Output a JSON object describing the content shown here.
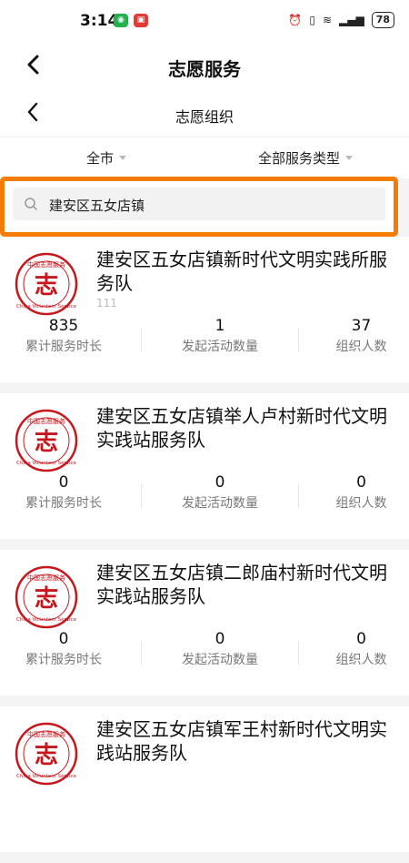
{
  "status": {
    "time": "3:14",
    "battery": "78",
    "app_badge_1_color": "#22b14c",
    "app_badge_2_color": "#e53935"
  },
  "nav": {
    "title": "志愿服务",
    "subtitle": "志愿组织"
  },
  "filters": {
    "area": "全市",
    "type": "全部服务类型"
  },
  "search": {
    "value": "建安区五女店镇"
  },
  "highlight_color": "#f57c00",
  "stat_labels": {
    "hours": "累计服务时长",
    "activities": "发起活动数量",
    "members": "组织人数"
  },
  "organizations": [
    {
      "name": "建安区五女店镇新时代文明实践所服务队",
      "sub": "111",
      "hours": "835",
      "activities": "1",
      "members": "37"
    },
    {
      "name": "建安区五女店镇举人卢村新时代文明实践站服务队",
      "sub": "",
      "hours": "0",
      "activities": "0",
      "members": "0"
    },
    {
      "name": "建安区五女店镇二郎庙村新时代文明实践站服务队",
      "sub": "",
      "hours": "0",
      "activities": "0",
      "members": "0"
    },
    {
      "name": "建安区五女店镇军王村新时代文明实践站服务队",
      "sub": "",
      "hours": "",
      "activities": "",
      "members": ""
    }
  ],
  "logo": {
    "icon": "china-volunteer-logo",
    "top_text": "中国志愿服务",
    "bottom_text": "China Volunteer Service",
    "char": "志",
    "color": "#c8161d"
  }
}
